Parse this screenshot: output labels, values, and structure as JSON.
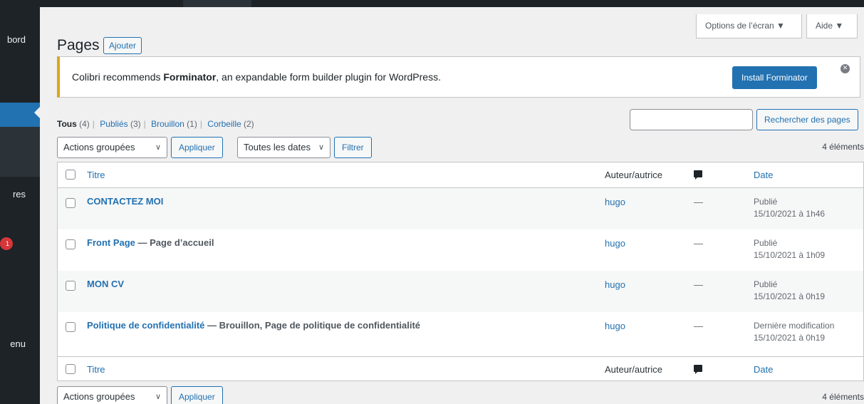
{
  "sidebar": {
    "items": [
      {
        "label": "bord"
      },
      {
        "label": "res"
      },
      {
        "label": "enu"
      }
    ],
    "badge": "1"
  },
  "header": {
    "screen_options": "Options de l’écran ▼",
    "help": "Aide ▼",
    "title": "Pages",
    "add_new": "Ajouter"
  },
  "notice": {
    "text_before": "Colibri recommends ",
    "plugin": "Forminator",
    "text_after": ", an expandable form builder plugin for WordPress.",
    "install_label": "Install Forminator",
    "dismiss_glyph": "✕"
  },
  "views": {
    "all": "Tous",
    "all_count": "(4)",
    "published": "Publiés",
    "published_count": "(3)",
    "draft": "Brouillon",
    "draft_count": "(1)",
    "trash": "Corbeille",
    "trash_count": "(2)",
    "separator": "|"
  },
  "search": {
    "value": "",
    "button": "Rechercher des pages"
  },
  "tablenav": {
    "bulk_actions": "Actions groupées",
    "apply": "Appliquer",
    "dates": "Toutes les dates",
    "filter": "Filtrer",
    "count": "4 éléments",
    "chevron": "∨"
  },
  "table": {
    "columns": {
      "title": "Titre",
      "author": "Auteur/autrice",
      "date": "Date"
    },
    "rows": [
      {
        "title": "CONTACTEZ MOI",
        "state": "",
        "author": "hugo",
        "comments": "—",
        "status": "Publié",
        "date": "15/10/2021 à 1h46"
      },
      {
        "title": "Front Page",
        "state": " — Page d’accueil",
        "author": "hugo",
        "comments": "—",
        "status": "Publié",
        "date": "15/10/2021 à 1h09"
      },
      {
        "title": "MON CV",
        "state": "",
        "author": "hugo",
        "comments": "—",
        "status": "Publié",
        "date": "15/10/2021 à 0h19"
      },
      {
        "title": "Politique de confidentialité",
        "state": " — Brouillon, Page de politique de confidentialité",
        "author": "hugo",
        "comments": "—",
        "status": "Dernière modification",
        "date": "15/10/2021 à 0h19"
      }
    ]
  },
  "colors": {
    "accent": "#2271b1",
    "sidebar": "#1d2327",
    "notice_border": "#dba617"
  }
}
